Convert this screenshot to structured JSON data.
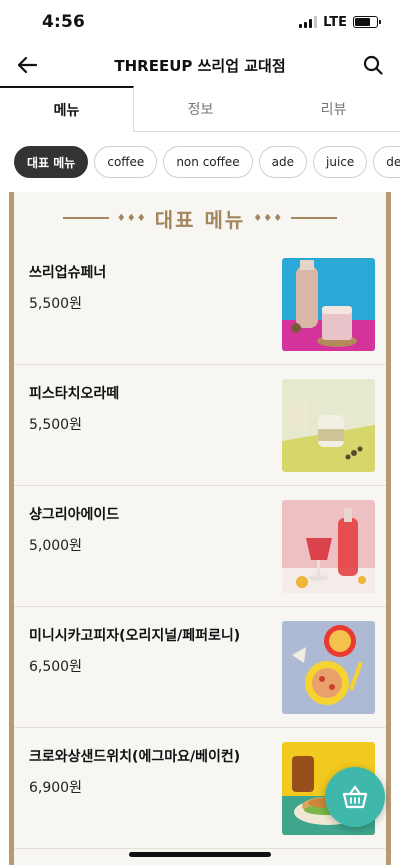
{
  "status": {
    "time": "4:56",
    "network": "LTE",
    "battery_level": 0.7
  },
  "header": {
    "title": "THREEUP 쓰리업 교대점",
    "back_icon": "back-arrow-icon",
    "search_icon": "search-icon"
  },
  "tabs": [
    {
      "label": "메뉴",
      "active": true
    },
    {
      "label": "정보",
      "active": false
    },
    {
      "label": "리뷰",
      "active": false
    }
  ],
  "categories": [
    {
      "label": "대표 메뉴",
      "active": true
    },
    {
      "label": "coffee"
    },
    {
      "label": "non coffee"
    },
    {
      "label": "ade"
    },
    {
      "label": "juice"
    },
    {
      "label": "des"
    }
  ],
  "section": {
    "title": "대표 메뉴",
    "ornament": "♦♦♦"
  },
  "menu_items": [
    {
      "name": "쓰리업슈페너",
      "price": "5,500원"
    },
    {
      "name": "피스타치오라떼",
      "price": "5,500원"
    },
    {
      "name": "샹그리아에이드",
      "price": "5,000원"
    },
    {
      "name": "미니시카고피자(오리지널/페퍼로니)",
      "price": "6,500원"
    },
    {
      "name": "크로와상샌드위치(에그마요/베이컨)",
      "price": "6,900원"
    }
  ],
  "cart_icon": "basket-icon",
  "colors": {
    "accent_gold": "#a3865c",
    "panel_border": "#b59a74",
    "fab": "#3fb8ab"
  }
}
